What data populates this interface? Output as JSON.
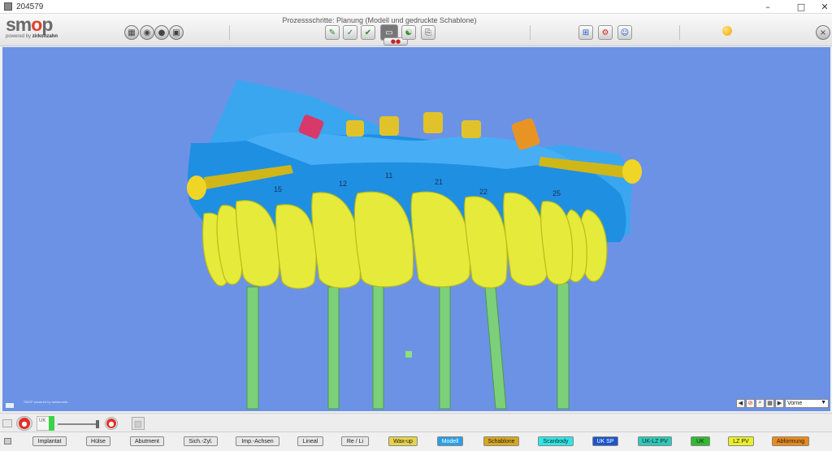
{
  "window": {
    "title": "204579"
  },
  "brand": {
    "name_prefix": "sm",
    "name_o": "o",
    "name_suffix": "p",
    "tagline_prefix": "powered by",
    "tagline_brand": "zirkonzahn"
  },
  "header": {
    "process_label": "Prozessschritte: Planung (Modell und gedruckte Schablone)"
  },
  "toolbar": {
    "left_icons": [
      "calculator-icon",
      "lightbulb-icon",
      "camera-roll-icon",
      "camera-icon"
    ],
    "process_icons": [
      "pencil-check-icon",
      "check-icon",
      "check-flag-icon",
      "template-icon",
      "person-export-icon",
      "document-export-icon"
    ],
    "right_icons": [
      "arrange-icon",
      "settings-gear-icon",
      "person-view-icon"
    ],
    "status_color": "#f0a400"
  },
  "viewport": {
    "background": "#6c92e6",
    "caption": "SMOP powered by swissmeda",
    "tooth_numbers": [
      "15",
      "12",
      "11",
      "21",
      "22",
      "25"
    ],
    "view_select": "Vorne"
  },
  "lower_controls": {
    "uk_label": "UK"
  },
  "bottom_buttons": [
    {
      "label": "Implantat",
      "color": "#e8e8e8"
    },
    {
      "label": "Hülse",
      "color": "#e8e8e8"
    },
    {
      "label": "Abutment",
      "color": "#e8e8e8"
    },
    {
      "label": "Sich.-Zyl.",
      "color": "#e8e8e8"
    },
    {
      "label": "Imp.-Achsen",
      "color": "#e8e8e8"
    },
    {
      "label": "Lineal",
      "color": "#e8e8e8"
    },
    {
      "label": "Re / Li",
      "color": "#e8e8e8"
    },
    {
      "label": "Wax-up",
      "color": "#e6d34a"
    },
    {
      "label": "Modell",
      "color": "#2c9ee6"
    },
    {
      "label": "Schablone",
      "color": "#d6a820"
    },
    {
      "label": "Scanbody",
      "color": "#2ee6e6"
    },
    {
      "label": "UK SP",
      "color": "#1f55c8"
    },
    {
      "label": "UK-LZ PV",
      "color": "#2ec9b8"
    },
    {
      "label": "UK",
      "color": "#33b833"
    },
    {
      "label": "LZ PV",
      "color": "#eaf02a"
    },
    {
      "label": "Abformung",
      "color": "#e88a1a"
    }
  ]
}
